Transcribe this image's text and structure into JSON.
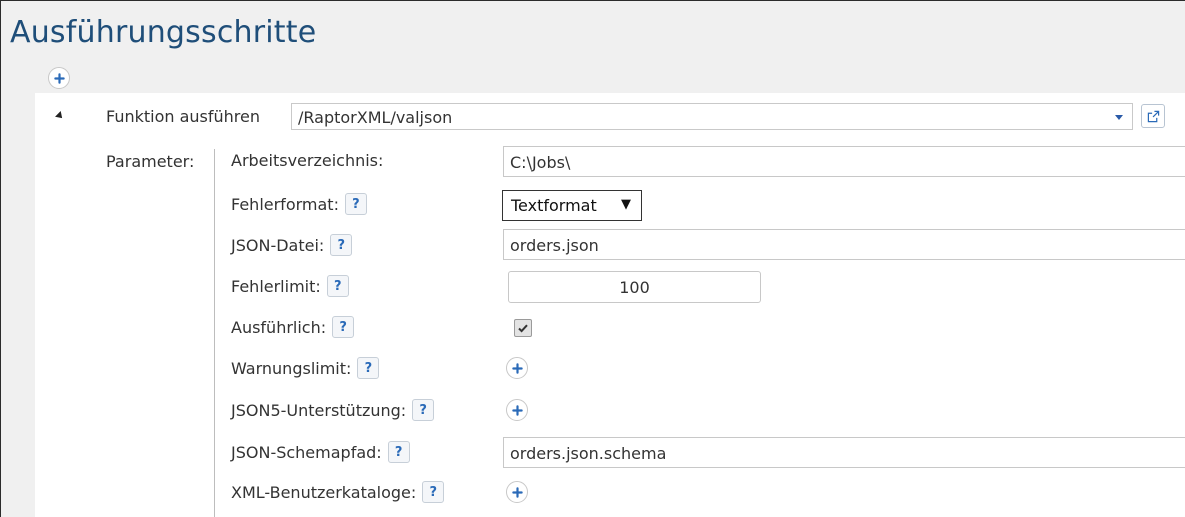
{
  "header": {
    "title": "Ausführungsschritte"
  },
  "step": {
    "function_label": "Funktion ausführen",
    "function_value": "/RaptorXML/valjson",
    "parameters_label": "Parameter:"
  },
  "params": {
    "working_dir": {
      "label": "Arbeitsverzeichnis:",
      "value": "C:\\Jobs\\"
    },
    "error_format": {
      "label": "Fehlerformat:",
      "value": "Textformat",
      "arrow": "▼"
    },
    "json_file": {
      "label": "JSON-Datei:",
      "value": "orders.json"
    },
    "error_limit": {
      "label": "Fehlerlimit:",
      "value": "100"
    },
    "verbose": {
      "label": "Ausführlich:",
      "checked": true
    },
    "warning_limit": {
      "label": "Warnungslimit:"
    },
    "json5_support": {
      "label": "JSON5-Unterstützung:"
    },
    "schema_path": {
      "label": "JSON-Schemapfad:",
      "value": "orders.json.schema"
    },
    "xml_catalogs": {
      "label": "XML-Benutzerkataloge:"
    }
  },
  "help_text": "?",
  "icons": {
    "add": "plus-icon",
    "open": "external-link-icon",
    "collapse": "collapse-arrow-icon",
    "dropdown": "caret-down-icon",
    "check": "checkmark-icon"
  },
  "colors": {
    "title": "#1f4e79",
    "accent": "#2a6ab8",
    "panel": "#f0f0f0"
  }
}
